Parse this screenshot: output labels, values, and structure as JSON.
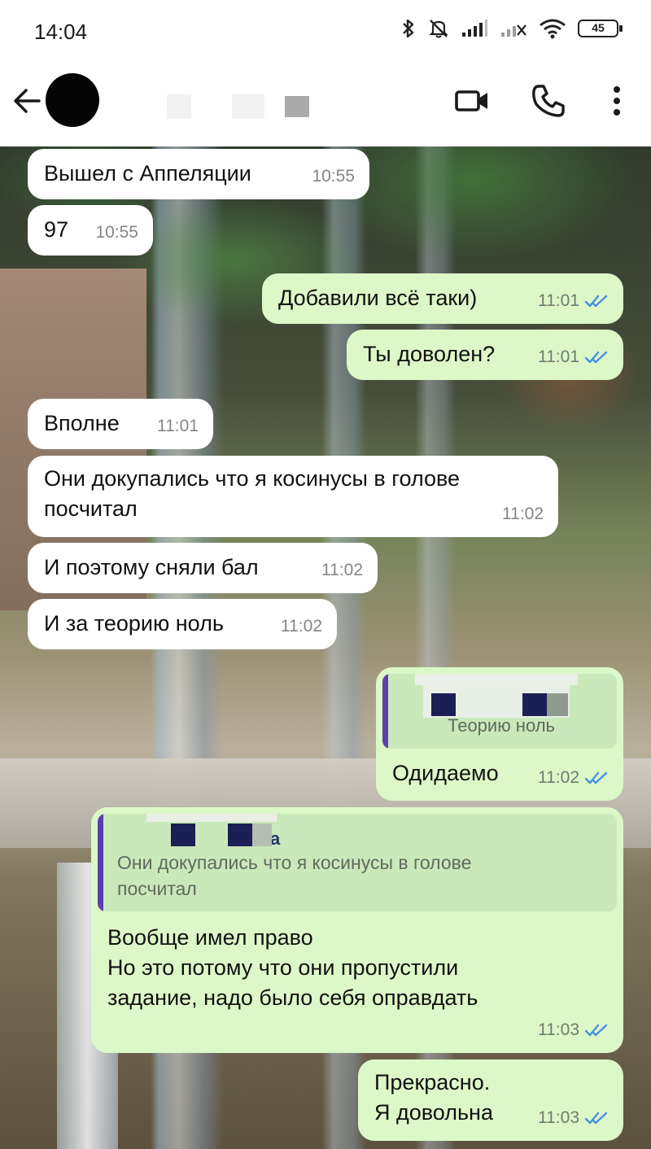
{
  "status_bar": {
    "time": "14:04",
    "battery": "45"
  },
  "header": {
    "back_icon": "arrow-left-icon",
    "video_icon": "video-camera-icon",
    "call_icon": "phone-icon",
    "menu_icon": "more-vertical-icon"
  },
  "messages": [
    {
      "dir": "in",
      "text": "Вышел с Аппеляции",
      "time": "10:55"
    },
    {
      "dir": "in",
      "text": "97",
      "time": "10:55"
    },
    {
      "dir": "out",
      "text": "Добавили всё таки)",
      "time": "11:01"
    },
    {
      "dir": "out",
      "text": "Ты доволен?",
      "time": "11:01"
    },
    {
      "dir": "in",
      "text": "Вполне",
      "time": "11:01"
    },
    {
      "dir": "in",
      "text": "Они докупались что я косинусы в голове\nпосчитал",
      "time": "11:02"
    },
    {
      "dir": "in",
      "text": "И поэтому сняли бал",
      "time": "11:02"
    },
    {
      "dir": "in",
      "text": "И за теорию ноль",
      "time": "11:02"
    },
    {
      "dir": "out",
      "text": "Одидаемо",
      "time": "11:02",
      "quote": {
        "text": "Теорию ноль"
      }
    },
    {
      "dir": "out",
      "text": "Вообще имел право\nНо это потому что они пропустили\nзадание, надо было себя оправдать",
      "time": "11:03",
      "quote": {
        "sender": "а",
        "text": "Они докупались что я косинусы в голове\nпосчитал"
      }
    },
    {
      "dir": "out",
      "text": "Прекрасно.\nЯ довольна",
      "time": "11:03"
    }
  ],
  "colors": {
    "outgoing_bubble": "#dcf8c8",
    "incoming_bubble": "#ffffff",
    "read_ticks": "#4a90e2",
    "quote_bar": "#5a3fb0"
  }
}
